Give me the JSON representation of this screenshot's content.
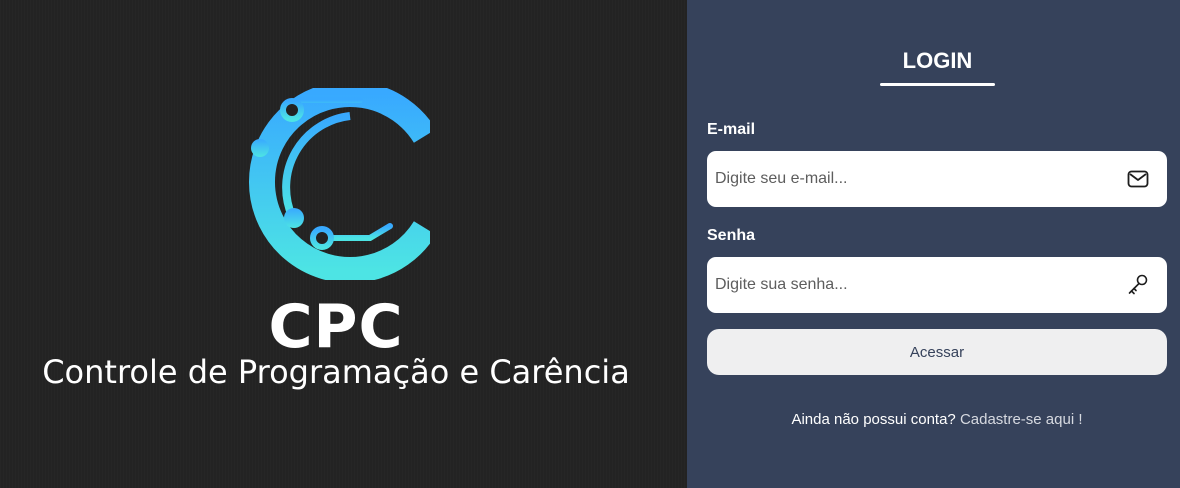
{
  "brand": {
    "name": "CPC",
    "subtitle": "Controle de Programação e Carência",
    "colors": {
      "gradient_top": "#38a9ff",
      "gradient_bottom": "#4de4e4"
    },
    "logo_icon": "circuit-c-logo"
  },
  "login": {
    "title": "LOGIN",
    "email": {
      "label": "E-mail",
      "placeholder": "Digite seu e-mail...",
      "value": "",
      "icon": "envelope-icon"
    },
    "password": {
      "label": "Senha",
      "placeholder": "Digite sua senha...",
      "value": "",
      "icon": "key-icon"
    },
    "submit_label": "Acessar",
    "signup_prompt": "Ainda não possui conta?",
    "signup_link": "Cadastre-se aqui !"
  },
  "colors": {
    "left_bg": "#232323",
    "right_bg": "#36425b",
    "button_bg": "#efeff0"
  }
}
